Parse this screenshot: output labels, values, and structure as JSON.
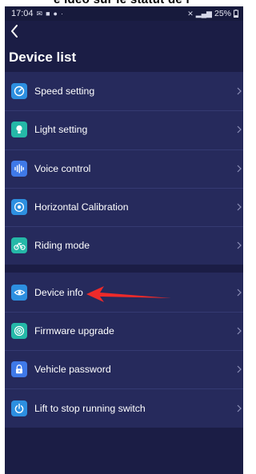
{
  "caption": "e ideo sur le statut de l",
  "status_bar": {
    "time": "17:04",
    "battery": "25%"
  },
  "header": {
    "title": "Device list"
  },
  "colors": {
    "background": "#1b1d45",
    "panel": "#262a5c",
    "divider": "#353a72",
    "annotation_arrow": "#ee2a2a"
  },
  "groups": [
    {
      "items": [
        {
          "label": "Speed setting",
          "icon": "speedometer-icon",
          "color": "#2d8fe0"
        },
        {
          "label": "Light setting",
          "icon": "lightbulb-icon",
          "color": "#25b8a8"
        },
        {
          "label": "Voice control",
          "icon": "voice-wave-icon",
          "color": "#3f79e8"
        },
        {
          "label": "Horizontal Calibration",
          "icon": "target-icon",
          "color": "#2d8fe0"
        },
        {
          "label": "Riding mode",
          "icon": "bicycle-icon",
          "color": "#25b8a8"
        }
      ]
    },
    {
      "items": [
        {
          "label": "Device info",
          "icon": "eye-icon",
          "color": "#2d8fe0"
        },
        {
          "label": "Firmware upgrade",
          "icon": "broadcast-icon",
          "color": "#25b8a8"
        },
        {
          "label": "Vehicle password",
          "icon": "lock-icon",
          "color": "#3f79e8"
        },
        {
          "label": "Lift to stop running switch",
          "icon": "power-icon",
          "color": "#2d8fe0"
        }
      ]
    }
  ]
}
